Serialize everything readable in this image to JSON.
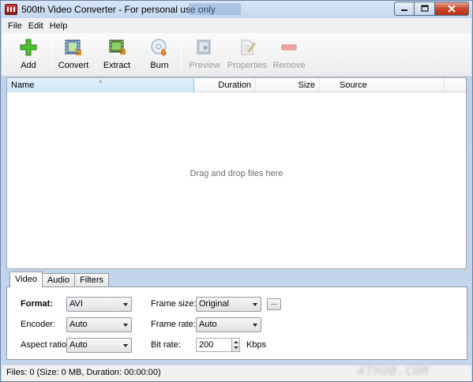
{
  "window": {
    "title": "500th Video Converter - For personal use only"
  },
  "menu": [
    "File",
    "Edit",
    "Help"
  ],
  "toolbar": {
    "add": "Add",
    "convert": "Convert",
    "extract": "Extract",
    "burn": "Burn",
    "preview": "Preview",
    "properties": "Properties",
    "remove": "Remove"
  },
  "file_list": {
    "columns": [
      "Name",
      "Duration",
      "Size",
      "Source"
    ],
    "drop_hint": "Drag and drop files here"
  },
  "tabs": [
    "Video",
    "Audio",
    "Filters"
  ],
  "video": {
    "format_label": "Format:",
    "format_value": "AVI",
    "encoder_label": "Encoder:",
    "encoder_value": "Auto",
    "aspect_label": "Aspect ratio:",
    "aspect_value": "Auto",
    "frame_size_label": "Frame size:",
    "frame_size_value": "Original",
    "browse_label": "...",
    "frame_rate_label": "Frame rate:",
    "frame_rate_value": "Auto",
    "bit_rate_label": "Bit rate:",
    "bit_rate_value": "200",
    "bit_rate_unit": "Kbps"
  },
  "status": {
    "text": "Files: 0 (Size: 0 MB, Duration: 00:00:00)"
  },
  "watermark": "ATHUB.COM",
  "colors": {
    "add_icon": "#3fae2a",
    "remove_icon": "#e05a5a",
    "title_bar": "#c9d9ee"
  }
}
